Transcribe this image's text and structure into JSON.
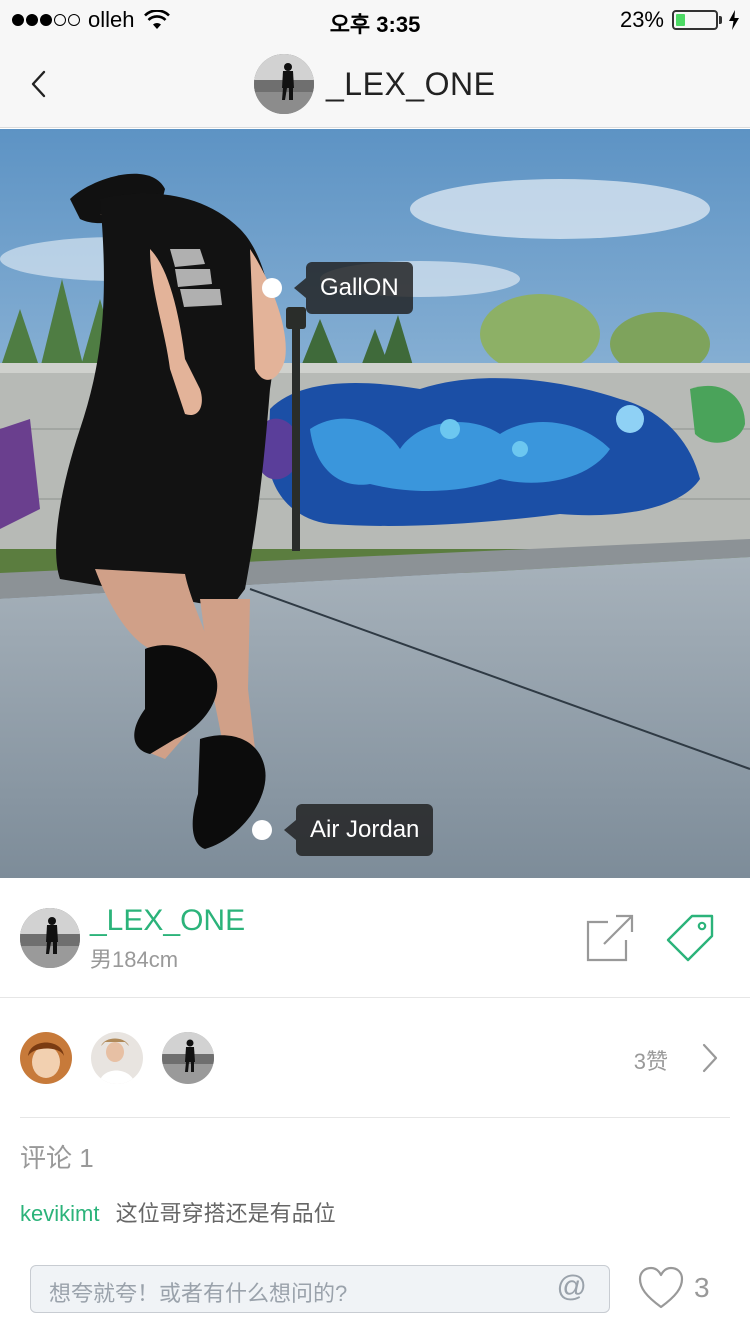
{
  "status_bar": {
    "carrier": "olleh",
    "time": "오후 3:35",
    "battery": "23%",
    "battery_level": 0.23
  },
  "header": {
    "title": "_LEX_ONE"
  },
  "photo": {
    "tags": [
      {
        "label": "GallON"
      },
      {
        "label": "Air Jordan"
      }
    ]
  },
  "user": {
    "name": "_LEX_ONE",
    "info": "男184cm"
  },
  "likes": {
    "count_label": "3赞"
  },
  "comments": {
    "title": "评论 1",
    "items": [
      {
        "user": "kevikimt",
        "text": "这位哥穿搭还是有品位"
      }
    ]
  },
  "input": {
    "placeholder": "想夸就夸！或者有什么想问的?",
    "at_symbol": "@"
  },
  "footer": {
    "like_count": "3"
  },
  "colors": {
    "accent": "#2bb37a",
    "muted": "#999999",
    "battery": "#4cd964"
  }
}
